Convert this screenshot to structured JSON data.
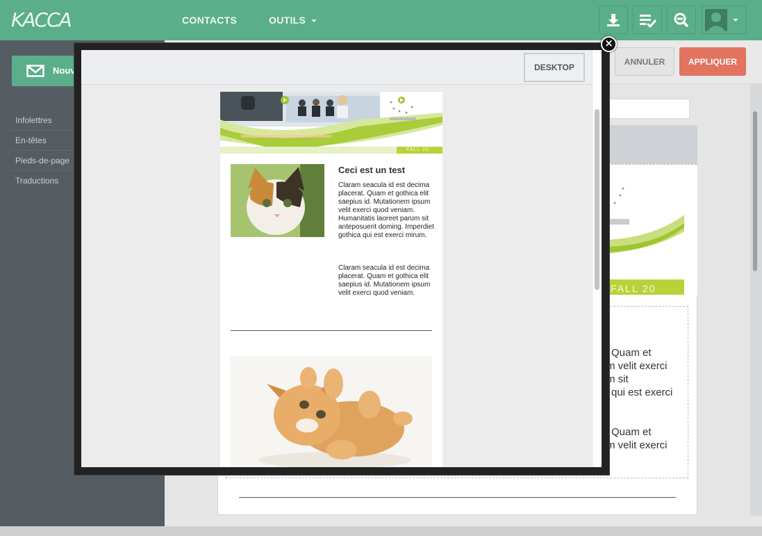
{
  "app": {
    "logo_text": "KACCA"
  },
  "topnav": {
    "items": [
      {
        "label": "CONTACTS",
        "has_dropdown": false
      },
      {
        "label": "OUTILS",
        "has_dropdown": true
      }
    ],
    "icons": [
      "download-icon",
      "checklist-icon",
      "zoom-out-icon"
    ],
    "accent_color": "#5aae8a"
  },
  "sidebar": {
    "new_button_label": "Nouv",
    "items": [
      {
        "label": "Infolettres"
      },
      {
        "label": "En-têtes"
      },
      {
        "label": "Pieds-de-page"
      },
      {
        "label": "Traductions"
      }
    ]
  },
  "editor": {
    "cancel_label": "ANNULER",
    "apply_label": "APPLIQUER",
    "apply_color": "#e1735f",
    "bg_header_fall": "FALL 20",
    "bg_lines": [
      "Quam et",
      "m velit exerci",
      "m sit",
      "qui est exerci",
      "Quam et",
      "m velit exerci"
    ]
  },
  "modal": {
    "view_button_label": "DESKTOP",
    "close_symbol": "×",
    "newsletter": {
      "fall_label": "FALL 20",
      "article_title": "Ceci est un test",
      "paragraph_1": "Claram seacula id est decima placerat. Quam et gothica elit saepius id. Mutationem ipsum velit exerci quod veniam. Humanitatis laoreet parum sit anteposuerit doming. Imperdiet gothica qui est exerci mirum.",
      "paragraph_2": "Claram seacula id est decima placerat. Quam et gothica elit saepius id. Mutationem ipsum velit exerci quod veniam."
    }
  }
}
